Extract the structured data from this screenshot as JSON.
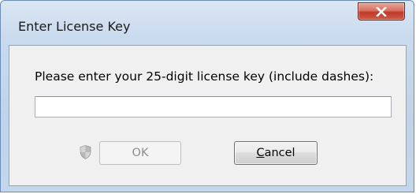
{
  "window": {
    "title": "Enter License Key",
    "close_icon": "close-icon"
  },
  "dialog": {
    "prompt": "Please enter your 25-digit license key (include dashes):",
    "license_key_value": "",
    "ok_label": "OK",
    "ok_enabled": false,
    "cancel_mnemonic": "C",
    "cancel_rest": "ancel",
    "shield_icon": "uac-shield-icon"
  },
  "colors": {
    "close_button": "#c0392b",
    "frame": "#bfd3ea",
    "client_bg": "#f0f0f0"
  }
}
